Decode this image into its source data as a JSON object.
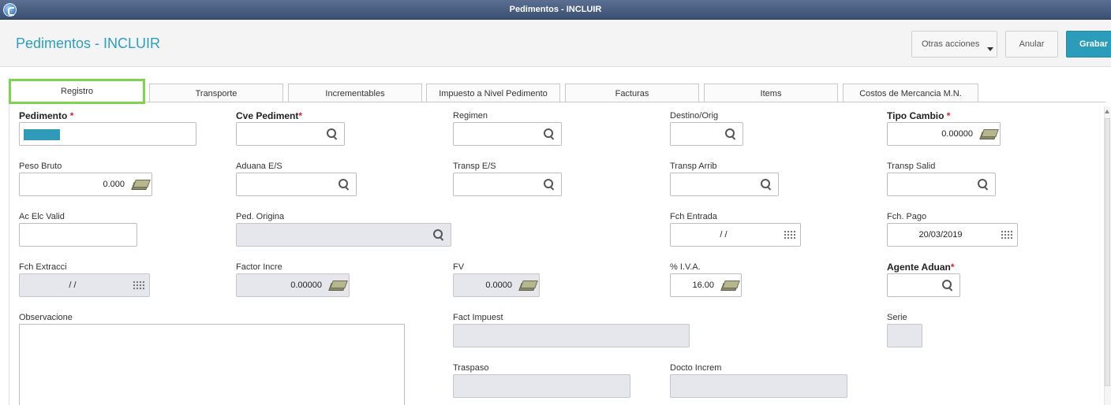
{
  "window": {
    "title": "Pedimentos - INCLUIR"
  },
  "header": {
    "page_title": "Pedimentos - INCLUIR",
    "buttons": {
      "otras_acciones": "Otras acciones",
      "anular": "Anular",
      "grabar": "Grabar"
    }
  },
  "tabs": [
    {
      "label": "Registro",
      "active": true
    },
    {
      "label": "Transporte"
    },
    {
      "label": "Incrementables"
    },
    {
      "label": "Impuesto a Nivel Pedimento"
    },
    {
      "label": "Facturas"
    },
    {
      "label": "Items"
    },
    {
      "label": "Costos de Mercancia M.N."
    }
  ],
  "form": {
    "pedimento": {
      "label": "Pedimento",
      "required": "*",
      "value": ""
    },
    "cve_pediment": {
      "label": "Cve Pediment",
      "required": "*",
      "value": ""
    },
    "regimen": {
      "label": "Regimen",
      "value": ""
    },
    "destino_orig": {
      "label": "Destino/Orig",
      "value": ""
    },
    "tipo_cambio": {
      "label": "Tipo Cambio",
      "required": "*",
      "value": "0.00000"
    },
    "peso_bruto": {
      "label": "Peso Bruto",
      "value": "0.000"
    },
    "aduana_es": {
      "label": "Aduana E/S",
      "value": ""
    },
    "transp_es": {
      "label": "Transp E/S",
      "value": ""
    },
    "transp_arrib": {
      "label": "Transp Arrib",
      "value": ""
    },
    "transp_salid": {
      "label": "Transp Salid",
      "value": ""
    },
    "ac_elc_valid": {
      "label": "Ac Elc Valid",
      "value": ""
    },
    "ped_origina": {
      "label": "Ped. Origina",
      "value": ""
    },
    "fch_entrada": {
      "label": "Fch Entrada",
      "value": "/  /"
    },
    "fch_pago": {
      "label": "Fch. Pago",
      "value": "20/03/2019"
    },
    "fch_extracci": {
      "label": "Fch Extracci",
      "value": "/  /"
    },
    "factor_incre": {
      "label": "Factor Incre",
      "value": "0.00000"
    },
    "fv": {
      "label": "FV",
      "value": "0.0000"
    },
    "iva": {
      "label": "% I.V.A.",
      "value": "16.00"
    },
    "agente_aduan": {
      "label": "Agente Aduan",
      "required": "*",
      "value": ""
    },
    "observacione": {
      "label": "Observacione",
      "value": ""
    },
    "fact_impuest": {
      "label": "Fact Impuest",
      "value": ""
    },
    "serie": {
      "label": "Serie",
      "value": ""
    },
    "traspaso": {
      "label": "Traspaso",
      "value": ""
    },
    "docto_increm": {
      "label": "Docto Increm",
      "value": ""
    }
  },
  "colors": {
    "accent": "#2b9dbb",
    "required": "#e02020",
    "tab_highlight": "#7fd34f",
    "titlebar": "#4a5e82"
  }
}
